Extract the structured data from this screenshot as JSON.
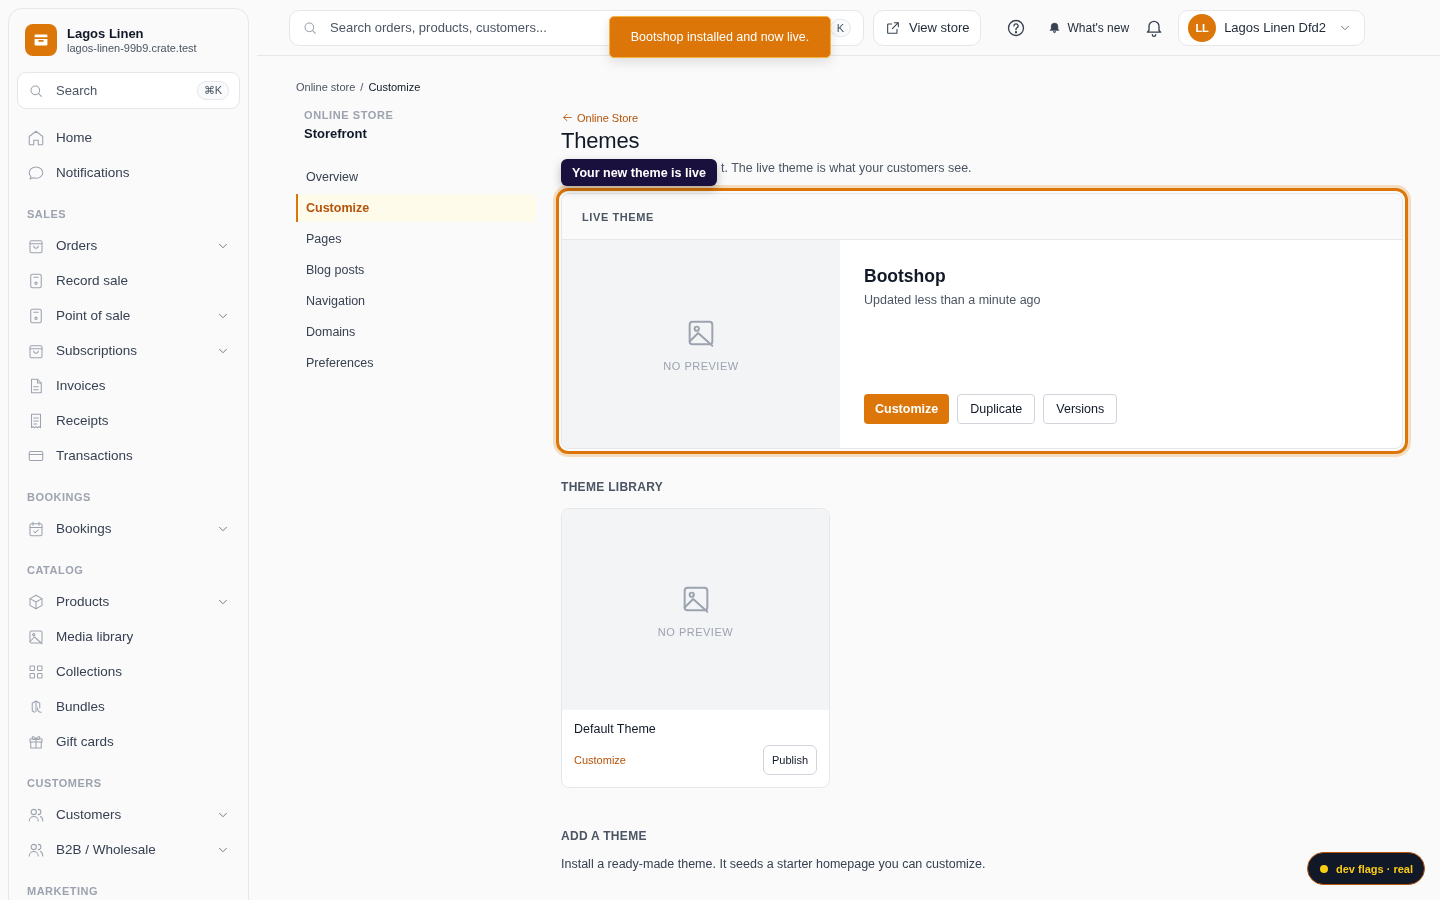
{
  "store": {
    "name": "Lagos Linen",
    "domain": "lagos-linen-99b9.crate.test"
  },
  "sidebar_search": {
    "placeholder": "Search",
    "shortcut": "⌘K"
  },
  "sidebar": {
    "sections": [
      {
        "items": [
          {
            "label": "Home",
            "expandable": false
          },
          {
            "label": "Notifications",
            "expandable": false
          }
        ]
      },
      {
        "label": "SALES",
        "items": [
          {
            "label": "Orders",
            "expandable": true
          },
          {
            "label": "Record sale",
            "expandable": false
          },
          {
            "label": "Point of sale",
            "expandable": true
          },
          {
            "label": "Subscriptions",
            "expandable": true
          },
          {
            "label": "Invoices",
            "expandable": false
          },
          {
            "label": "Receipts",
            "expandable": false
          },
          {
            "label": "Transactions",
            "expandable": false
          }
        ]
      },
      {
        "label": "BOOKINGS",
        "items": [
          {
            "label": "Bookings",
            "expandable": true
          }
        ]
      },
      {
        "label": "CATALOG",
        "items": [
          {
            "label": "Products",
            "expandable": true
          },
          {
            "label": "Media library",
            "expandable": false
          },
          {
            "label": "Collections",
            "expandable": false
          },
          {
            "label": "Bundles",
            "expandable": false
          },
          {
            "label": "Gift cards",
            "expandable": false
          }
        ]
      },
      {
        "label": "CUSTOMERS",
        "items": [
          {
            "label": "Customers",
            "expandable": true
          },
          {
            "label": "B2B / Wholesale",
            "expandable": true
          }
        ]
      },
      {
        "label": "MARKETING"
      }
    ]
  },
  "topbar": {
    "search": {
      "placeholder": "Search orders, products, customers...",
      "shortcut": "K"
    },
    "view_store": "View store",
    "whats_new": "What's new",
    "user": {
      "initials": "LL",
      "name": "Lagos Linen Dfd2"
    }
  },
  "toast": "Bootshop installed and now live.",
  "breadcrumb": {
    "items": [
      "Online store",
      "Customize"
    ],
    "separator": "/"
  },
  "subnav": {
    "eyebrow": "ONLINE STORE",
    "title": "Storefront",
    "items": [
      {
        "label": "Overview",
        "selected": false
      },
      {
        "label": "Customize",
        "selected": true
      },
      {
        "label": "Pages",
        "selected": false
      },
      {
        "label": "Blog posts",
        "selected": false
      },
      {
        "label": "Navigation",
        "selected": false
      },
      {
        "label": "Domains",
        "selected": false
      },
      {
        "label": "Preferences",
        "selected": false
      }
    ]
  },
  "page": {
    "back": "Online Store",
    "title": "Themes",
    "description": "t. The live theme is what your customers see.",
    "tooltip": "Your new theme is live"
  },
  "live_theme": {
    "heading": "LIVE THEME",
    "highlighted": true,
    "preview": "NO PREVIEW",
    "name": "Bootshop",
    "updated": "Updated less than a minute ago",
    "actions": [
      {
        "label": "Customize",
        "kind": "primary"
      },
      {
        "label": "Duplicate",
        "kind": "secondary"
      },
      {
        "label": "Versions",
        "kind": "secondary"
      }
    ]
  },
  "library": {
    "heading": "THEME LIBRARY",
    "themes": [
      {
        "name": "Default Theme",
        "preview": "NO PREVIEW",
        "customize": "Customize",
        "publish": "Publish"
      }
    ]
  },
  "add_theme": {
    "heading": "ADD A THEME",
    "description": "Install a ready-made theme. It seeds a starter homepage you can customize."
  },
  "dev_badge": "dev flags · real"
}
